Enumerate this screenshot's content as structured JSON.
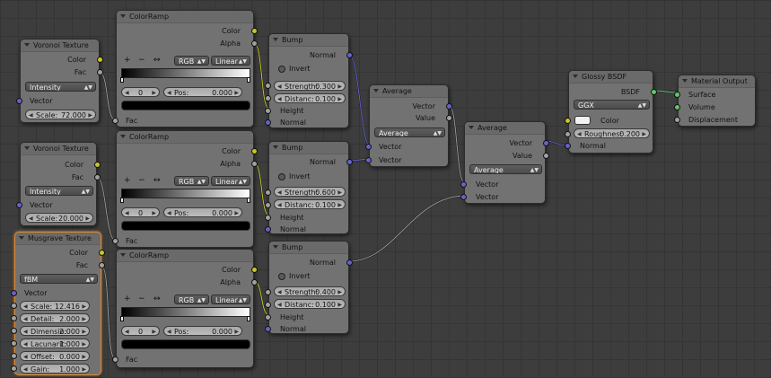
{
  "colors": {
    "background": "#3d3d3d",
    "node_body": "#727272",
    "socket_color": "#c7c729",
    "socket_float": "#a1a1a1",
    "socket_vector": "#6363c7",
    "socket_shader": "#63c763",
    "active_border": "#d78a3a"
  },
  "voronoi1": {
    "title": "Voronoi Texture",
    "out_color": "Color",
    "out_fac": "Fac",
    "coloring": "Intensity",
    "in_vector": "Vector",
    "scale_label": "Scale:",
    "scale_value": "72.000"
  },
  "voronoi2": {
    "title": "Voronoi Texture",
    "out_color": "Color",
    "out_fac": "Fac",
    "coloring": "Intensity",
    "in_vector": "Vector",
    "scale_label": "Scale:",
    "scale_value": "20.000"
  },
  "musgrave": {
    "title": "Musgrave Texture",
    "out_color": "Color",
    "out_fac": "Fac",
    "type": "fBM",
    "in_vector": "Vector",
    "params": [
      {
        "label": "Scale:",
        "value": "12.416"
      },
      {
        "label": "Detail:",
        "value": "2.000"
      },
      {
        "label": "Dimensio:",
        "value": "2.000"
      },
      {
        "label": "Lacunarit:",
        "value": "1.000"
      },
      {
        "label": "Offset:",
        "value": "0.000"
      },
      {
        "label": "Gain:",
        "value": "1.000"
      }
    ]
  },
  "ramp1": {
    "title": "ColorRamp",
    "out_color": "Color",
    "out_alpha": "Alpha",
    "add": "+",
    "remove": "−",
    "flip": "↔",
    "mode": "RGB",
    "interp": "Linear",
    "index": "0",
    "pos_label": "Pos:",
    "pos_value": "0.000",
    "in_fac": "Fac"
  },
  "ramp2": {
    "title": "ColorRamp",
    "out_color": "Color",
    "out_alpha": "Alpha",
    "add": "+",
    "remove": "−",
    "flip": "↔",
    "mode": "RGB",
    "interp": "Linear",
    "index": "0",
    "pos_label": "Pos:",
    "pos_value": "0.000",
    "in_fac": "Fac"
  },
  "ramp3": {
    "title": "ColorRamp",
    "out_color": "Color",
    "out_alpha": "Alpha",
    "add": "+",
    "remove": "−",
    "flip": "↔",
    "mode": "RGB",
    "interp": "Linear",
    "index": "0",
    "pos_label": "Pos:",
    "pos_value": "0.000",
    "in_fac": "Fac"
  },
  "bump1": {
    "title": "Bump",
    "out_normal": "Normal",
    "invert": "Invert",
    "strength_label": "Strength:",
    "strength_value": "0.300",
    "distance_label": "Distanc:",
    "distance_value": "0.100",
    "in_height": "Height",
    "in_normal": "Normal"
  },
  "bump2": {
    "title": "Bump",
    "out_normal": "Normal",
    "invert": "Invert",
    "strength_label": "Strength:",
    "strength_value": "0.600",
    "distance_label": "Distanc:",
    "distance_value": "0.100",
    "in_height": "Height",
    "in_normal": "Normal"
  },
  "bump3": {
    "title": "Bump",
    "out_normal": "Normal",
    "invert": "Invert",
    "strength_label": "Strength:",
    "strength_value": "0.400",
    "distance_label": "Distanc:",
    "distance_value": "0.100",
    "in_height": "Height",
    "in_normal": "Normal"
  },
  "avg1": {
    "title": "Average",
    "out_vector": "Vector",
    "out_value": "Value",
    "operation": "Average",
    "in_vector1": "Vector",
    "in_vector2": "Vector"
  },
  "avg2": {
    "title": "Average",
    "out_vector": "Vector",
    "out_value": "Value",
    "operation": "Average",
    "in_vector1": "Vector",
    "in_vector2": "Vector"
  },
  "glossy": {
    "title": "Glossy BSDF",
    "out_bsdf": "BSDF",
    "distribution": "GGX",
    "in_color": "Color",
    "roughness_label": "Roughnes:",
    "roughness_value": "0.200",
    "in_normal": "Normal"
  },
  "output": {
    "title": "Material Output",
    "in_surface": "Surface",
    "in_volume": "Volume",
    "in_displacement": "Displacement"
  }
}
